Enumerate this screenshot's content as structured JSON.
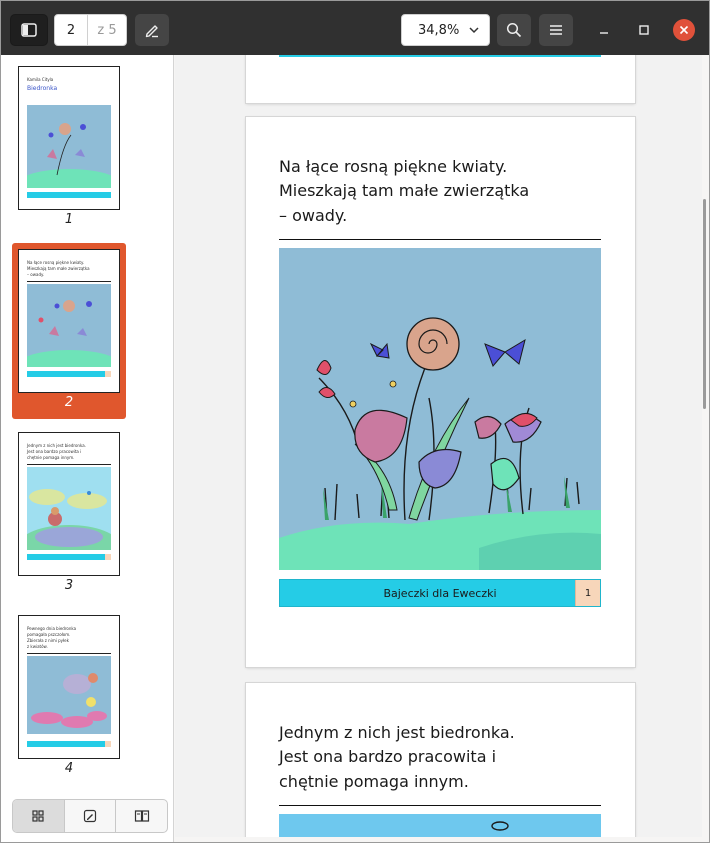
{
  "toolbar": {
    "sidebar_toggle_icon": "sidebar-toggle-icon",
    "current_page": "2",
    "total_pages": "z 5",
    "annotate_icon": "pencil-icon",
    "zoom": "34,8%",
    "search_icon": "search-icon",
    "menu_icon": "hamburger-menu-icon",
    "minimize_icon": "minimize-icon",
    "maximize_icon": "maximize-icon",
    "close_icon": "close-icon"
  },
  "thumbnails": [
    {
      "number": "1",
      "lines": [
        "Kamila Cityla"
      ],
      "title": "Biedronka",
      "footer": "Bajeczki dla Eweczki"
    },
    {
      "number": "2",
      "lines": [
        "Na łące rosną piękne kwiaty.",
        "Mieszkają tam małe zwierzątka",
        "– owady."
      ],
      "footer": "Bajeczki dla Eweczki",
      "page_no": "1",
      "selected": true
    },
    {
      "number": "3",
      "lines": [
        "Jednym z nich jest biedronka.",
        "Jest ona bardzo pracowita i",
        "chętnie pomaga innym."
      ],
      "footer": "Bajeczki dla Eweczki",
      "page_no": "2"
    },
    {
      "number": "4",
      "lines": [
        "Pewnego dnia biedronka",
        "pomagała pszczołom.",
        "Zbierała z nimi pyłek",
        "z kwiatów."
      ],
      "footer": "Bajeczki dla Eweczki",
      "page_no": "3"
    }
  ],
  "sidebar_switcher": {
    "thumbnails_icon": "grid-icon",
    "annotations_icon": "edit-icon",
    "outline_icon": "book-icon"
  },
  "document": {
    "page2": {
      "lines": [
        "Na łące rosną piękne kwiaty.",
        "Mieszkają tam małe zwierzątka",
        "– owady."
      ],
      "footer": "Bajeczki dla Eweczki",
      "page_no": "1"
    },
    "page3": {
      "lines": [
        "Jednym z nich jest biedronka.",
        "Jest ona bardzo pracowita i",
        "chętnie pomaga innym."
      ]
    }
  },
  "colors": {
    "accent": "#e0572d",
    "footer_bar": "#25cce6",
    "page_number_bg": "#f7d6ba",
    "illustration_sky": "#8fbcd6",
    "header_bg": "#303030",
    "close_button": "#e0513a"
  }
}
